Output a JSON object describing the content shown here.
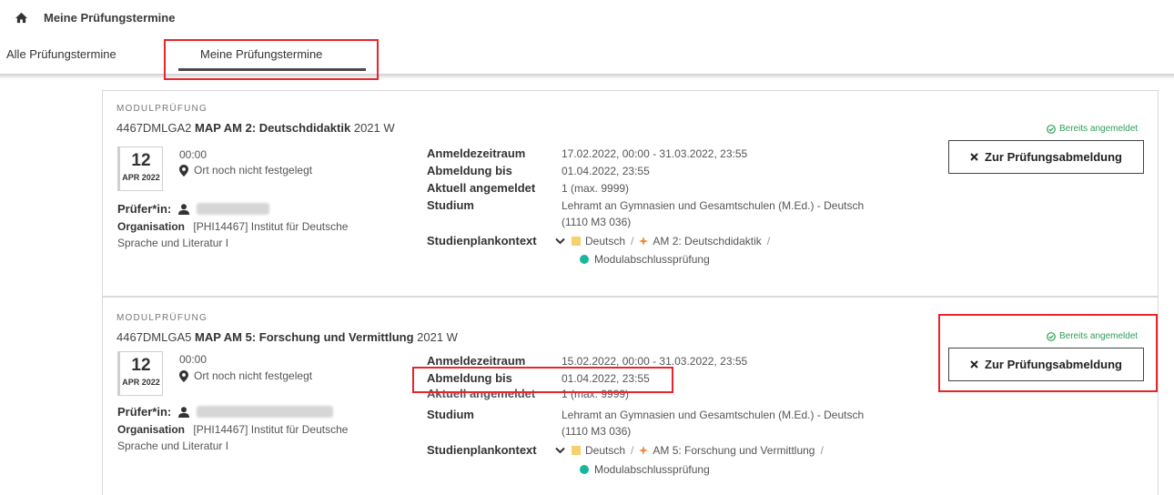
{
  "breadcrumb": {
    "current": "Meine Prüfungstermine"
  },
  "tabs": [
    {
      "label": "Alle Prüfungstermine",
      "active": false
    },
    {
      "label": "Meine Prüfungstermine",
      "active": true
    }
  ],
  "labels": {
    "pruefer": "Prüfer*in:",
    "organisation": "Organisation",
    "anmeldezeitraum": "Anmeldezeitraum",
    "abmeldung_bis": "Abmeldung bis",
    "aktuell_angemeldet": "Aktuell angemeldet",
    "studium": "Studium",
    "studienplankontext": "Studienplankontext"
  },
  "exams": [
    {
      "kind": "MODULPRÜFUNG",
      "code": "4467DMLGA2",
      "title": "MAP AM 2: Deutschdidaktik",
      "semester": "2021 W",
      "day": "12",
      "month": "APR 2022",
      "time": "00:00",
      "location": "Ort noch nicht festgelegt",
      "org_line1": "[PHI14467] Institut für Deutsche",
      "org_line2": "Sprache und Literatur I",
      "anmeldezeitraum": "17.02.2022, 00:00 - 31.03.2022, 23:55",
      "abmeldung_bis": "01.04.2022, 23:55",
      "aktuell_angemeldet": "1 (max. 9999)",
      "studium_line1": "Lehramt an Gymnasien und Gesamtschulen (M.Ed.) - Deutsch",
      "studium_line2": "(1110 M3 036)",
      "ctx_1": "Deutsch",
      "ctx_2": "AM 2: Deutschdidaktik",
      "ctx_3": "Modulabschlussprüfung",
      "status": "Bereits angemeldet",
      "button": "Zur Prüfungsabmeldung"
    },
    {
      "kind": "MODULPRÜFUNG",
      "code": "4467DMLGA5",
      "title": "MAP AM 5: Forschung und Vermittlung",
      "semester": "2021 W",
      "day": "12",
      "month": "APR 2022",
      "time": "00:00",
      "location": "Ort noch nicht festgelegt",
      "org_line1": "[PHI14467] Institut für Deutsche",
      "org_line2": "Sprache und Literatur I",
      "anmeldezeitraum": "15.02.2022, 00:00 - 31.03.2022, 23:55",
      "abmeldung_bis": "01.04.2022, 23:55",
      "aktuell_angemeldet": "1 (max. 9999)",
      "studium_line1": "Lehramt an Gymnasien und Gesamtschulen (M.Ed.) - Deutsch",
      "studium_line2": "(1110 M3 036)",
      "ctx_1": "Deutsch",
      "ctx_2": "AM 5: Forschung und Vermittlung",
      "ctx_3": "Modulabschlussprüfung",
      "status": "Bereits angemeldet",
      "button": "Zur Prüfungsabmeldung"
    }
  ],
  "colors": {
    "highlight": "#e8252a",
    "status_green": "#2f9e5a",
    "deutsch_square": "#f5d06b",
    "module_diamond": "#f08a3c",
    "exam_dot": "#17b79a"
  },
  "icons": [
    "home-icon",
    "pin-icon",
    "user-icon",
    "chevron-down-icon",
    "check-circle-icon",
    "close-icon",
    "diamond-icon"
  ]
}
